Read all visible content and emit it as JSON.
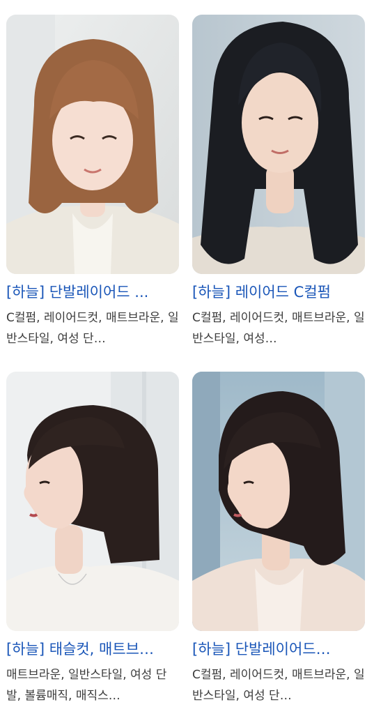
{
  "results": [
    {
      "title": "[하늘] 단발레이어드 ...",
      "description": "C컬펌, 레이어드컷, 매트브라운, 일반스타일, 여성 단…",
      "image": "brown-layered-bob-photo"
    },
    {
      "title": "[하늘] 레이어드 C컬펌",
      "description": "C컬펌, 레이어드컷, 매트브라운, 일반스타일, 여성…",
      "image": "long-black-layered-hair-photo"
    },
    {
      "title": "[하늘] 태슬컷, 매트브…",
      "description": "매트브라운, 일반스타일, 여성 단발, 볼륨매직, 매직스…",
      "image": "dark-bob-side-profile-photo"
    },
    {
      "title": "[하늘] 단발레이어드…",
      "description": "C컬펌, 레이어드컷, 매트브라운, 일반스타일, 여성 단…",
      "image": "dark-layered-bob-side-profile-photo"
    }
  ],
  "colors": {
    "title_link": "#1a56b8",
    "description_text": "#3c3c3c"
  }
}
